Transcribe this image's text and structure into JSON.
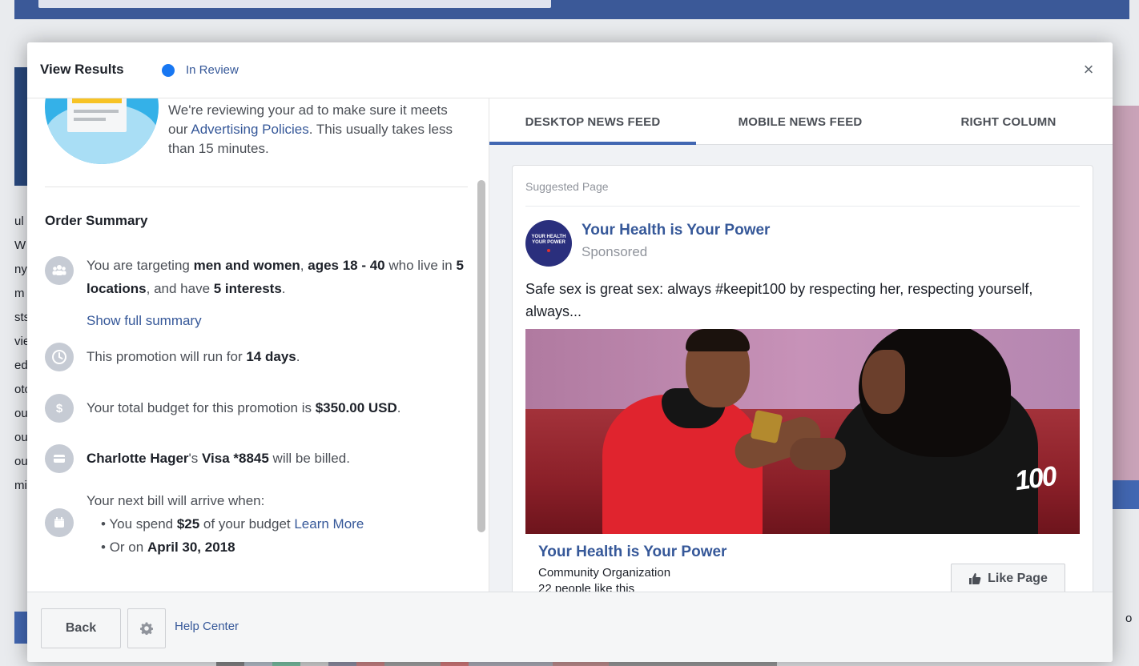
{
  "background": {
    "edge_letters": [
      "ul",
      "W",
      "ny",
      "m",
      "sts",
      "vie",
      "ed",
      "oto",
      "ou",
      "ou",
      "ou",
      "mi"
    ],
    "right_edge_text": "o"
  },
  "modal": {
    "title": "View Results",
    "status": "In Review",
    "close_label": "×"
  },
  "review": {
    "text_before": "We're reviewing your ad to make sure it meets our ",
    "link": "Advertising Policies",
    "text_after": ". This usually takes less than 15 minutes."
  },
  "order_summary": {
    "title": "Order Summary",
    "targeting": {
      "p1": "You are targeting ",
      "b1": "men and women",
      "p2": ", ",
      "b2": "ages 18 - 40",
      "p3": " who live in ",
      "b3": "5 locations",
      "p4": ", and have ",
      "b4": "5 interests",
      "p5": "."
    },
    "show_full_summary": "Show full summary",
    "duration": {
      "p1": "This promotion will run for ",
      "b1": "14 days",
      "p2": "."
    },
    "budget": {
      "p1": "Your total budget for this promotion is ",
      "b1": "$350.00 USD",
      "p2": "."
    },
    "billing": {
      "b1": "Charlotte Hager",
      "p1": "'s ",
      "b2": "Visa *8845",
      "p2": " will be billed."
    },
    "next_bill": {
      "intro": "Your next bill will arrive when:",
      "bullet1_p1": "You spend ",
      "bullet1_b": "$25",
      "bullet1_p2": " of your budget ",
      "bullet1_link": "Learn More",
      "bullet2_p1": "Or on ",
      "bullet2_b": "April 30, 2018"
    }
  },
  "tabs": [
    {
      "label": "DESKTOP NEWS FEED",
      "active": true
    },
    {
      "label": "MOBILE NEWS FEED",
      "active": false
    },
    {
      "label": "RIGHT COLUMN",
      "active": false
    }
  ],
  "ad_preview": {
    "suggested_label": "Suggested Page",
    "avatar_text": [
      "YOUR HEALTH",
      "YOUR POWER"
    ],
    "page_name": "Your Health is Your Power",
    "sponsored": "Sponsored",
    "post_text": "Safe sex is great sex: always #keepit100 by respecting her, respecting yourself, always...",
    "image_overlay_text": "100",
    "link_title": "Your Health is Your Power",
    "category": "Community Organization",
    "likes": "22 people like this",
    "like_button": "Like Page"
  },
  "footer": {
    "back_label": "Back",
    "help_center": "Help Center"
  },
  "colors": {
    "accent": "#4267b2",
    "link": "#365899",
    "status_dot": "#1877f2"
  }
}
